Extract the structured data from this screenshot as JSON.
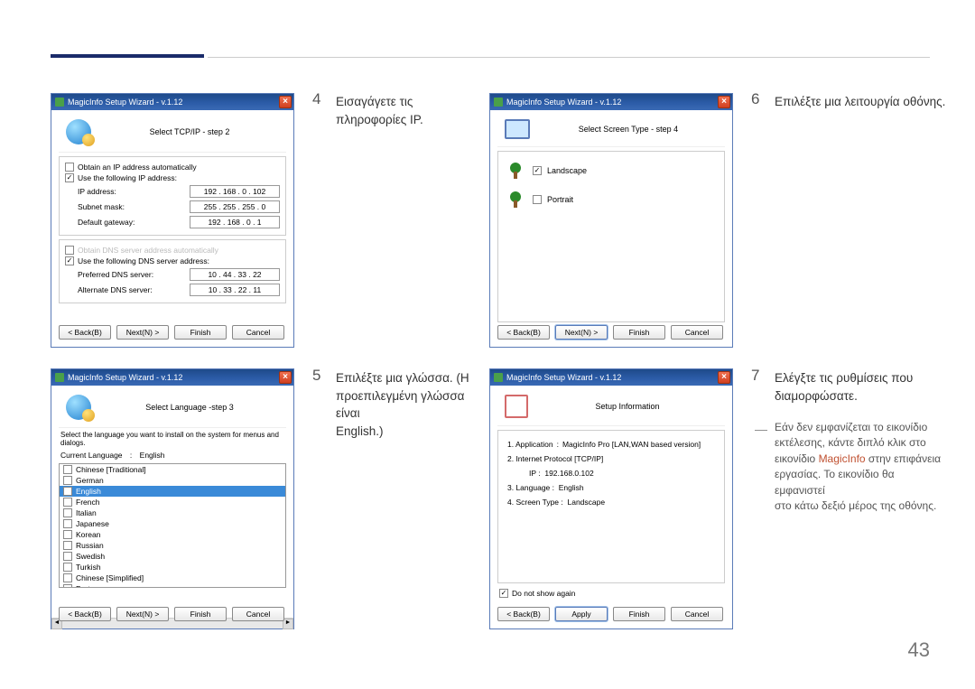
{
  "page_number": "43",
  "wizard_title": "MagicInfo Setup Wizard - v.1.12",
  "step4": {
    "num": "4",
    "instruction": "Εισαγάγετε τις πληροφορίες IP.",
    "header": "Select TCP/IP - step 2",
    "auto_ip": "Obtain an IP address automatically",
    "use_ip": "Use the following IP address:",
    "ip_label": "IP address:",
    "ip_val": "192 . 168 .   0  . 102",
    "mask_label": "Subnet mask:",
    "mask_val": "255 . 255 . 255 .   0",
    "gw_label": "Default gateway:",
    "gw_val": "192 . 168 .   0  .    1",
    "auto_dns": "Obtain DNS server address automatically",
    "use_dns": "Use the following DNS server address:",
    "pdns_label": "Preferred DNS server:",
    "pdns_val": "10 .  44 .  33 .  22",
    "adns_label": "Alternate DNS server:",
    "adns_val": "10 .  33 .  22 .  11"
  },
  "step5": {
    "num": "5",
    "instruction_line1": "Επιλέξτε μια γλώσσα. (Η",
    "instruction_line2": "προεπιλεγμένη γλώσσα είναι",
    "instruction_line3": "English.)",
    "header": "Select Language -step 3",
    "desc": "Select the language you want to install on the system for menus and dialogs.",
    "current_label": "Current Language",
    "current_val": "English",
    "languages": [
      "Chinese [Traditional]",
      "German",
      "English",
      "French",
      "Italian",
      "Japanese",
      "Korean",
      "Russian",
      "Swedish",
      "Turkish",
      "Chinese [Simplified]",
      "Portuguese"
    ],
    "selected_index": 2
  },
  "step6": {
    "num": "6",
    "instruction": "Επιλέξτε μια λειτουργία οθόνης.",
    "header": "Select Screen Type - step 4",
    "landscape": "Landscape",
    "portrait": "Portrait"
  },
  "step7": {
    "num": "7",
    "instruction_line1": "Ελέγξτε τις ρυθμίσεις που",
    "instruction_line2": "διαμορφώσατε.",
    "header": "Setup Information",
    "row1_label": "1. Application",
    "row1_val": "MagicInfo Pro [LAN,WAN based version]",
    "row2": "2. Internet Protocol [TCP/IP]",
    "row2_ip_label": "IP :",
    "row2_ip_val": "192.168.0.102",
    "row3_label": "3. Language :",
    "row3_val": "English",
    "row4_label": "4. Screen Type :",
    "row4_val": "Landscape",
    "dont_show": "Do not show again",
    "note_l1": "Εάν δεν εμφανίζεται το εικονίδιο",
    "note_l2": "εκτέλεσης, κάντε διπλό κλικ στο",
    "note_l3a": "εικονίδιο ",
    "note_l3b": "MagicInfo",
    "note_l3c": " στην επιφάνεια",
    "note_l4": "εργασίας. Το εικονίδιο θα εμφανιστεί",
    "note_l5": "στο κάτω δεξιό μέρος της οθόνης."
  },
  "buttons": {
    "back": "< Back(B)",
    "next": "Next(N) >",
    "finish": "Finish",
    "cancel": "Cancel",
    "apply": "Apply"
  }
}
